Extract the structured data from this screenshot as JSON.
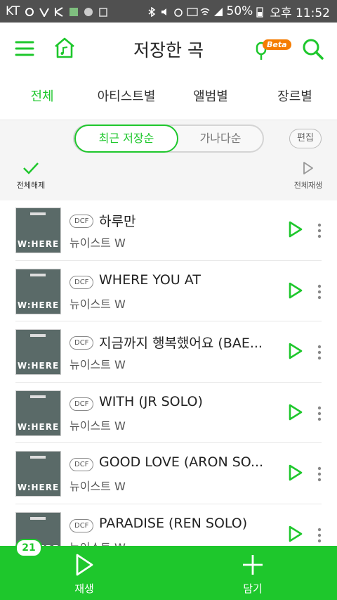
{
  "status_bar": {
    "carrier": "KT",
    "battery": "50%",
    "time": "오후 11:52"
  },
  "header": {
    "title": "저장한 곡",
    "beta_label": "Beta"
  },
  "tabs": [
    {
      "label": "전체",
      "active": true
    },
    {
      "label": "아티스트별",
      "active": false
    },
    {
      "label": "앨범별",
      "active": false
    },
    {
      "label": "장르별",
      "active": false
    }
  ],
  "toolbar": {
    "sort_recent": "최근 저장순",
    "sort_alpha": "가나다순",
    "edit": "편집",
    "deselect_all": "전체해제",
    "play_all": "전체재생"
  },
  "songs": [
    {
      "title": "하루만",
      "artist": "뉴이스트 W",
      "badge": "DCF"
    },
    {
      "title": "WHERE YOU AT",
      "artist": "뉴이스트 W",
      "badge": "DCF"
    },
    {
      "title": "지금까지 행복했어요 (BAE...",
      "artist": "뉴이스트 W",
      "badge": "DCF"
    },
    {
      "title": "WITH (JR SOLO)",
      "artist": "뉴이스트 W",
      "badge": "DCF"
    },
    {
      "title": "GOOD LOVE (ARON SO...",
      "artist": "뉴이스트 W",
      "badge": "DCF"
    },
    {
      "title": "PARADISE (REN SOLO)",
      "artist": "뉴이스트 W",
      "badge": "DCF"
    }
  ],
  "album_art_text": "W:HERE",
  "bottom": {
    "count": "21",
    "play": "재생",
    "add": "담기"
  },
  "colors": {
    "accent": "#1ec72c",
    "status_bar": "#505050"
  }
}
